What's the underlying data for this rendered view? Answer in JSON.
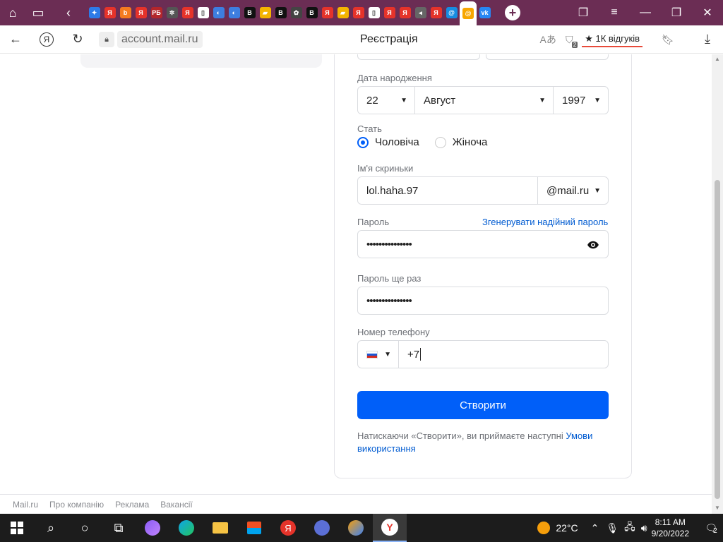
{
  "browser": {
    "tabs": [
      {
        "icon": "mosaic-icon",
        "color": "#2e7be8",
        "glyph": "✦"
      },
      {
        "icon": "yandex-icon",
        "color": "#e5332a",
        "glyph": "Я"
      },
      {
        "icon": "orange-b-icon",
        "color": "#f47b20",
        "glyph": "b"
      },
      {
        "icon": "yandex-icon",
        "color": "#e5332a",
        "glyph": "Я"
      },
      {
        "icon": "rg-icon",
        "color": "#b3262b",
        "glyph": "РБ"
      },
      {
        "icon": "ball-icon",
        "color": "#555555",
        "glyph": "✲"
      },
      {
        "icon": "yandex-icon",
        "color": "#e5332a",
        "glyph": "Я"
      },
      {
        "icon": "document-icon",
        "color": "#ffffff",
        "glyph": "▯"
      },
      {
        "icon": "browser-icon",
        "color": "#3d7ee0",
        "glyph": "◐"
      },
      {
        "icon": "browser-icon",
        "color": "#3d7ee0",
        "glyph": "◐"
      },
      {
        "icon": "b-icon",
        "color": "#111111",
        "glyph": "В"
      },
      {
        "icon": "image-icon",
        "color": "#f4b400",
        "glyph": "▰"
      },
      {
        "icon": "b-icon",
        "color": "#111111",
        "glyph": "В"
      },
      {
        "icon": "gear-icon",
        "color": "#444444",
        "glyph": "✿"
      },
      {
        "icon": "b-icon",
        "color": "#111111",
        "glyph": "В"
      },
      {
        "icon": "yandex-icon",
        "color": "#e5332a",
        "glyph": "Я"
      },
      {
        "icon": "image-icon",
        "color": "#f4b400",
        "glyph": "▰"
      },
      {
        "icon": "yandex-icon",
        "color": "#e5332a",
        "glyph": "Я"
      },
      {
        "icon": "document-icon",
        "color": "#ffffff",
        "glyph": "▯"
      },
      {
        "icon": "yandex-icon",
        "color": "#e5332a",
        "glyph": "Я"
      },
      {
        "icon": "yandex-icon",
        "color": "#e5332a",
        "glyph": "Я"
      },
      {
        "icon": "speaker-icon",
        "color": "#666666",
        "glyph": "◂"
      },
      {
        "icon": "yandex-icon",
        "color": "#e5332a",
        "glyph": "Я"
      },
      {
        "icon": "mail-at-icon",
        "color": "#168de2",
        "glyph": "@"
      },
      {
        "icon": "mail-at-icon",
        "color": "#f7a600",
        "glyph": "@",
        "active": true
      },
      {
        "icon": "vk-icon",
        "color": "#2787f5",
        "glyph": "vk"
      }
    ],
    "url": "account.mail.ru",
    "page_title": "Реєстрація",
    "reviews_label": "★ 1К відгуків",
    "shield_badge": "2"
  },
  "form": {
    "birth_label": "Дата народження",
    "birth_day": "22",
    "birth_month": "Август",
    "birth_year": "1997",
    "gender_label": "Стать",
    "gender_male": "Чоловіча",
    "gender_female": "Жіноча",
    "gender_selected": "male",
    "mailbox_label": "Ім'я скриньки",
    "mailbox_value": "lol.haha.97",
    "mailbox_domain": "@mail.ru",
    "password_label": "Пароль",
    "generate_link": "Згенерувати надійний пароль",
    "password_mask": "•••••••••••••••",
    "password_repeat_label": "Пароль ще раз",
    "password_repeat_mask": "•••••••••••••••",
    "phone_label": "Номер телефону",
    "phone_value": "+7",
    "create_button": "Створити",
    "terms_text": "Натискаючи «Створити», ви приймаєте наступні ",
    "terms_link": "Умови використання"
  },
  "footer": {
    "links": [
      "Mail.ru",
      "Про компанію",
      "Реклама",
      "Вакансії"
    ]
  },
  "taskbar": {
    "weather": "22°C",
    "time": "8:11 AM",
    "date": "9/20/2022",
    "notifications": "2"
  },
  "colors": {
    "accent": "#005ff9",
    "link": "#005bd1",
    "tabstrip": "#6b2d54"
  }
}
